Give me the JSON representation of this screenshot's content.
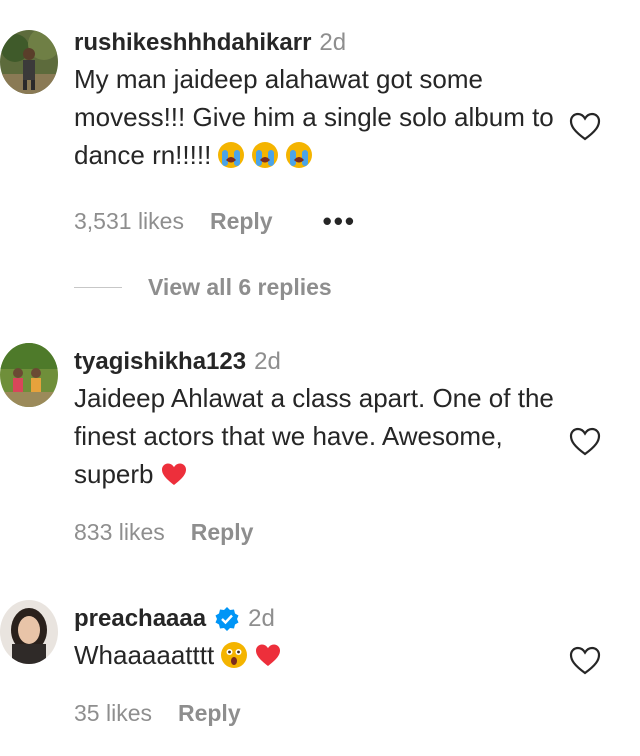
{
  "comments": [
    {
      "username": "rushikeshhhdahikarr",
      "time": "2d",
      "text": "My man jaideep alahawat got some movess!!! Give him a single solo album to dance rn!!!!!",
      "emojis": [
        "loudly-crying-face-emoji",
        "loudly-crying-face-emoji",
        "loudly-crying-face-emoji"
      ],
      "likes": "3,531 likes",
      "reply": "Reply",
      "more": "•••",
      "verified": false
    },
    {
      "username": "tyagishikha123",
      "time": "2d",
      "text": "Jaideep Ahlawat a class apart. One of the finest actors that we have. Awesome, superb",
      "emojis": [
        "red-heart-emoji"
      ],
      "likes": "833 likes",
      "reply": "Reply",
      "verified": false
    },
    {
      "username": "preachaaaa",
      "time": "2d",
      "text": "Whaaaaatttt",
      "emojis": [
        "astonished-face-emoji",
        "red-heart-emoji"
      ],
      "likes": "35 likes",
      "reply": "Reply",
      "verified": true
    }
  ],
  "view_replies": "View all 6 replies",
  "colors": {
    "text": "#262626",
    "secondary": "#8e8e8e",
    "verified": "#0095f6",
    "heart": "#ed2f3b"
  }
}
